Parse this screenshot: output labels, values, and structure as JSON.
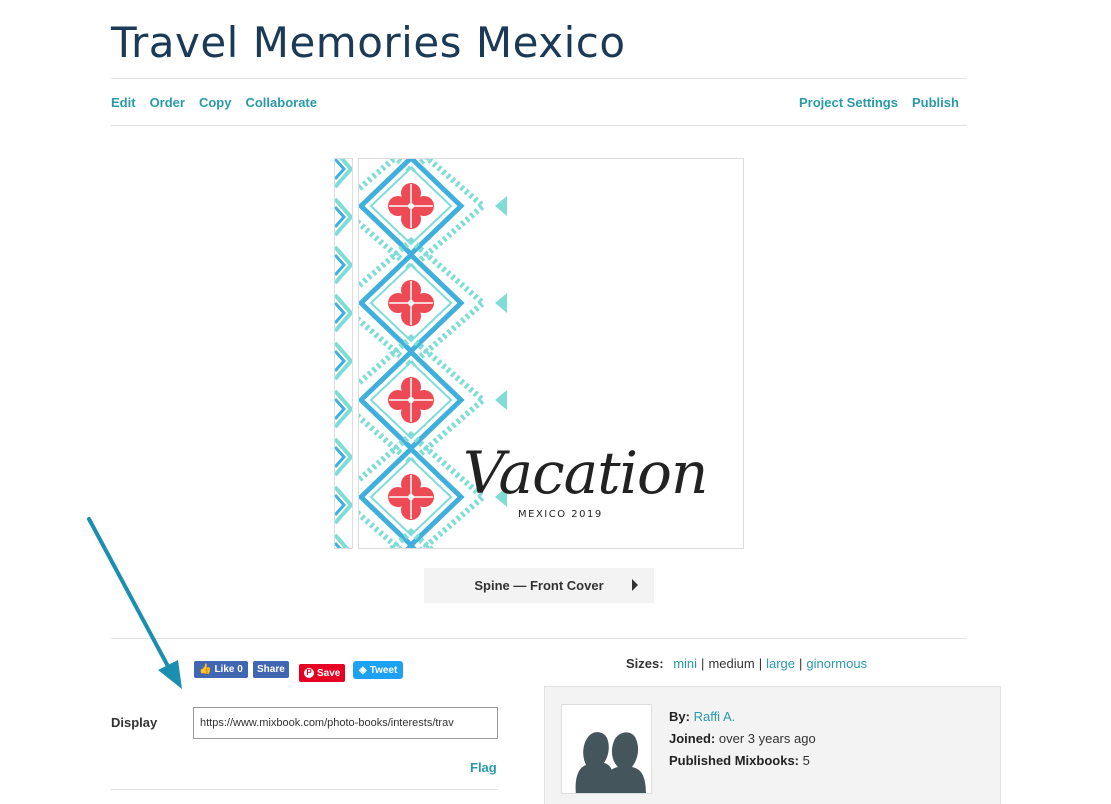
{
  "project": {
    "title": "Travel Memories Mexico"
  },
  "nav": {
    "left": [
      "Edit",
      "Order",
      "Copy",
      "Collaborate"
    ],
    "right": [
      "Project Settings",
      "Publish"
    ]
  },
  "cover": {
    "script_text": "Vacation",
    "subtitle": "MEXICO 2019"
  },
  "page_navigator": {
    "label": "Spine — Front Cover"
  },
  "social": {
    "like_label": "Like 0",
    "share_label": "Share",
    "pin_label": "Save",
    "tweet_label": "Tweet"
  },
  "display": {
    "label": "Display",
    "url": "https://www.mixbook.com/photo-books/interests/trav"
  },
  "flag_label": "Flag",
  "sizes": {
    "label": "Sizes:",
    "options": [
      "mini",
      "medium",
      "large",
      "ginormous"
    ],
    "selected": "medium"
  },
  "author": {
    "by_label": "By:",
    "name": "Raffi A.",
    "joined_label": "Joined:",
    "joined_value": "over 3 years ago",
    "published_label": "Published Mixbooks:",
    "published_count": "5"
  },
  "colors": {
    "accent": "#2a9aa8",
    "title": "#1b3a57",
    "tile_red": "#ee4a55",
    "tile_blue": "#3fb0dd",
    "tile_teal": "#7fdcd6",
    "arrow": "#1a8fb0"
  }
}
